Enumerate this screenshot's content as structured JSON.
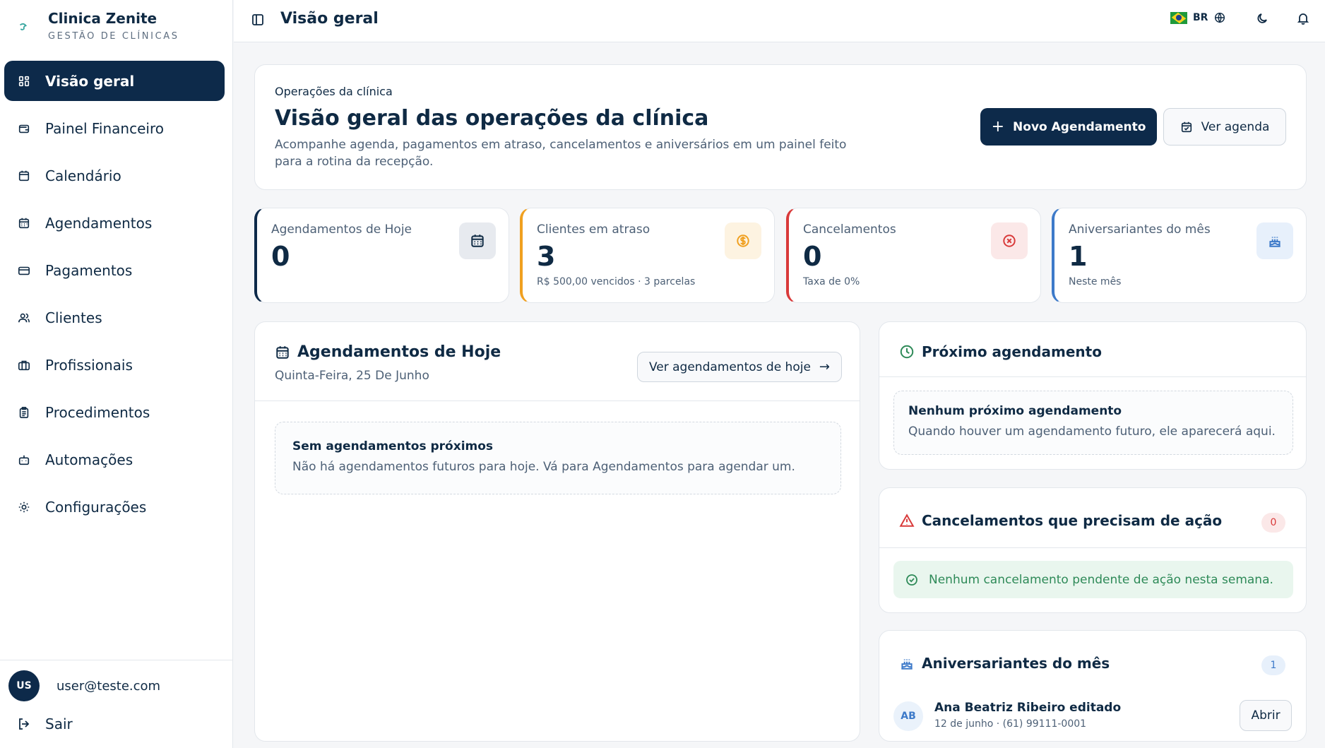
{
  "brand": {
    "name": "Clinica Zenite",
    "subtitle": "GESTÃO DE CLÍNICAS",
    "logo_icon": "brand-logo-icon"
  },
  "sidebar": {
    "items": [
      {
        "label": "Visão geral",
        "icon": "grid-icon",
        "active": true
      },
      {
        "label": "Painel Financeiro",
        "icon": "wallet-icon"
      },
      {
        "label": "Calendário",
        "icon": "calendar-icon"
      },
      {
        "label": "Agendamentos",
        "icon": "calendar-days-icon"
      },
      {
        "label": "Pagamentos",
        "icon": "credit-card-icon"
      },
      {
        "label": "Clientes",
        "icon": "users-icon"
      },
      {
        "label": "Profissionais",
        "icon": "briefcase-icon"
      },
      {
        "label": "Procedimentos",
        "icon": "clipboard-icon"
      },
      {
        "label": "Automações",
        "icon": "bot-icon"
      },
      {
        "label": "Configurações",
        "icon": "gear-icon"
      }
    ],
    "user": {
      "initials": "US",
      "email": "user@teste.com"
    },
    "logout_label": "Sair"
  },
  "topbar": {
    "title": "Visão geral",
    "lang_code": "BR"
  },
  "hero": {
    "eyebrow": "Operações da clínica",
    "title": "Visão geral das operações da clínica",
    "description": "Acompanhe agenda, pagamentos em atraso, cancelamentos e aniversários em um painel feito para a rotina da recepção.",
    "primary_button": "Novo Agendamento",
    "secondary_button": "Ver agenda"
  },
  "stats": [
    {
      "label": "Agendamentos de Hoje",
      "value": "0",
      "sub": "",
      "color": "#0d2a4a",
      "icon": "calendar-icon"
    },
    {
      "label": "Clientes em atraso",
      "value": "3",
      "sub": "R$ 500,00 vencidos · 3 parcelas",
      "color": "#f0a020",
      "icon": "dollar-circle-icon"
    },
    {
      "label": "Cancelamentos",
      "value": "0",
      "sub": "Taxa de 0%",
      "color": "#d93a3a",
      "icon": "x-circle-icon"
    },
    {
      "label": "Aniversariantes do mês",
      "value": "1",
      "sub": "Neste mês",
      "color": "#3d7ac9",
      "icon": "cake-icon"
    }
  ],
  "today": {
    "title": "Agendamentos de Hoje",
    "date": "Quinta-Feira, 25 De Junho",
    "button": "Ver agendamentos de hoje",
    "empty_title": "Sem agendamentos próximos",
    "empty_text": "Não há agendamentos futuros para hoje. Vá para Agendamentos para agendar um."
  },
  "next": {
    "title": "Próximo agendamento",
    "empty_title": "Nenhum próximo agendamento",
    "empty_text": "Quando houver um agendamento futuro, ele aparecerá aqui."
  },
  "cancellations": {
    "title": "Cancelamentos que precisam de ação",
    "count": "0",
    "message": "Nenhum cancelamento pendente de ação nesta semana."
  },
  "birthdays": {
    "title": "Aniversariantes do mês",
    "count": "1",
    "people": [
      {
        "initials": "AB",
        "name": "Ana Beatriz Ribeiro editado",
        "meta": "12 de junho · (61) 99111-0001",
        "button": "Abrir"
      }
    ]
  },
  "colors": {
    "primary": "#0d2a4a",
    "warning": "#f0a020",
    "danger": "#d93a3a",
    "info": "#3d7ac9",
    "success": "#2e8a58"
  }
}
